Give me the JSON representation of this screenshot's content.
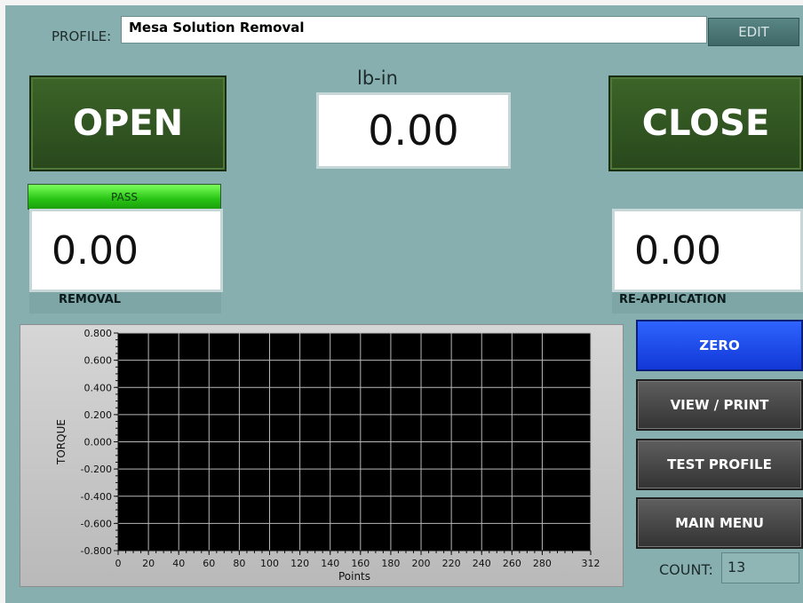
{
  "profile": {
    "label": "PROFILE:",
    "value": "Mesa Solution Removal",
    "edit_label": "EDIT"
  },
  "buttons": {
    "open": "OPEN",
    "close": "CLOSE",
    "zero": "ZERO",
    "view_print": "VIEW / PRINT",
    "test_profile": "TEST PROFILE",
    "main_menu": "MAIN MENU"
  },
  "torque": {
    "unit": "lb-in",
    "value": "0.00"
  },
  "removal": {
    "status": "PASS",
    "value": "0.00",
    "label": "REMOVAL"
  },
  "reapplication": {
    "value": "0.00",
    "label": "RE-APPLICATION"
  },
  "count": {
    "label": "COUNT:",
    "value": "13"
  },
  "colors": {
    "panel": "#88afaf",
    "open_close": "#2f5621",
    "pass": "#3fe21f",
    "zero": "#1e4cf0",
    "gray_button": "#484848",
    "plot_bg": "#000000"
  },
  "chart_data": {
    "type": "line",
    "title": "",
    "xlabel": "Points",
    "ylabel": "TORQUE",
    "xlim": [
      0,
      312
    ],
    "ylim": [
      -0.8,
      0.8
    ],
    "x_ticks": [
      "0",
      "20",
      "40",
      "60",
      "80",
      "100",
      "120",
      "140",
      "160",
      "180",
      "200",
      "220",
      "240",
      "260",
      "280",
      "312"
    ],
    "y_ticks": [
      "0.800",
      "0.600",
      "0.400",
      "0.200",
      "0.000",
      "-0.200",
      "-0.400",
      "-0.600",
      "-0.800"
    ],
    "grid": true,
    "series": []
  }
}
